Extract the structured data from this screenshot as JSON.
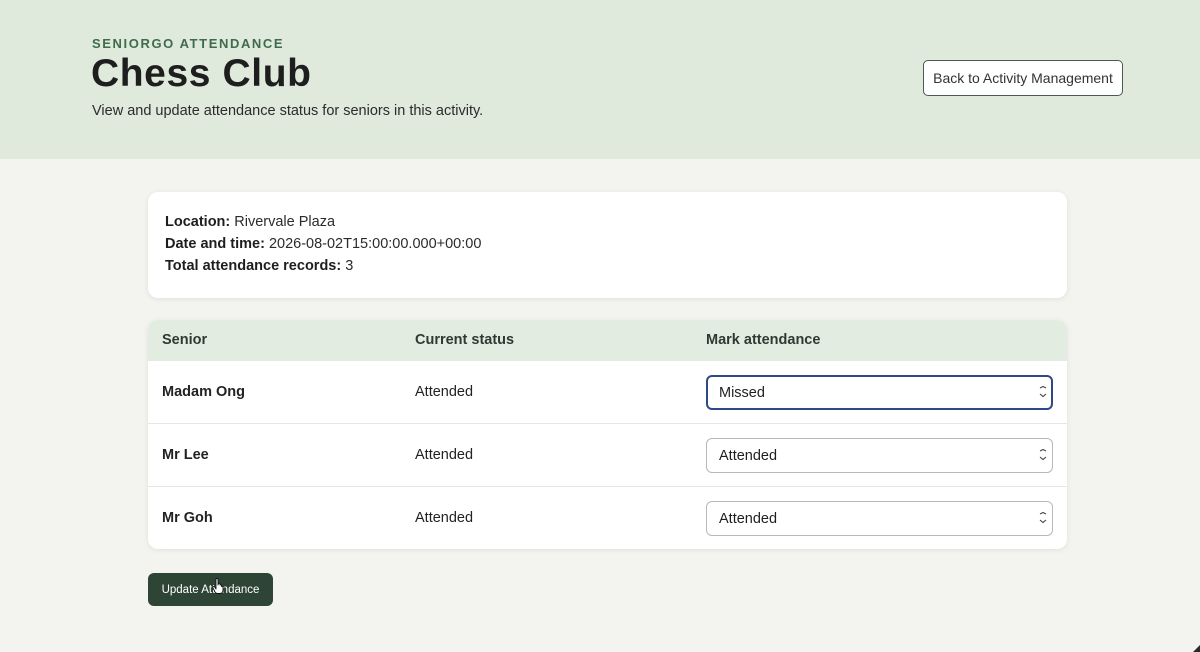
{
  "header": {
    "eyebrow": "SENIORGO ATTENDANCE",
    "title": "Chess Club",
    "subtitle": "View and update attendance status for seniors in this activity.",
    "back_label": "Back to Activity Management"
  },
  "info": {
    "location_label": "Location:",
    "location_value": "Rivervale Plaza",
    "datetime_label": "Date and time:",
    "datetime_value": "2026-08-02T15:00:00.000+00:00",
    "total_label": "Total attendance records:",
    "total_value": "3"
  },
  "table": {
    "headers": [
      "Senior",
      "Current status",
      "Mark attendance"
    ],
    "rows": [
      {
        "senior": "Madam Ong",
        "current_status": "Attended",
        "mark": "Missed"
      },
      {
        "senior": "Mr Lee",
        "current_status": "Attended",
        "mark": "Attended"
      },
      {
        "senior": "Mr Goh",
        "current_status": "Attended",
        "mark": "Attended"
      }
    ]
  },
  "actions": {
    "update_label": "Update Attendance"
  },
  "icons": {
    "select_chevron": "chevron-down-icon",
    "cursor": "hand-pointer-icon"
  },
  "colors": {
    "header_bg": "#dfeadd",
    "accent": "#3f6b4c",
    "button_bg": "#2e4434",
    "focus_border": "#2e4a86"
  }
}
